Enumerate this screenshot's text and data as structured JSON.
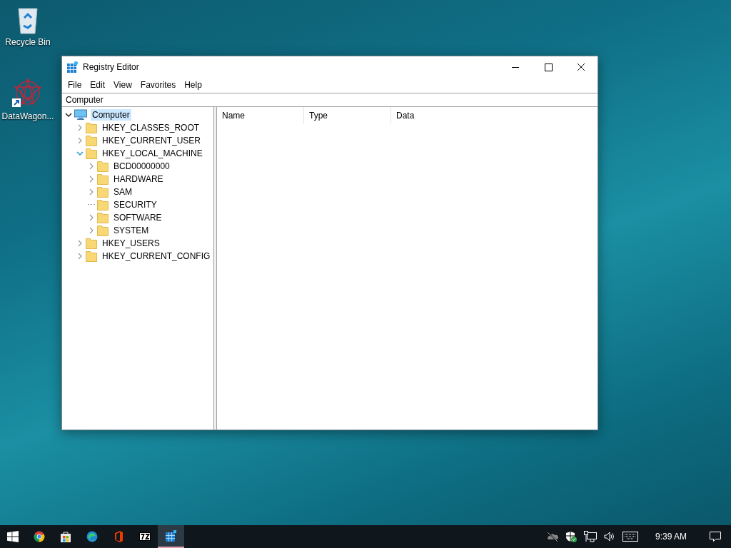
{
  "desktop_icons": [
    {
      "kind": "recycle",
      "label": "Recycle Bin"
    },
    {
      "kind": "shortcut",
      "label": "DataWagon..."
    }
  ],
  "window": {
    "title": "Registry Editor",
    "menu": [
      "File",
      "Edit",
      "View",
      "Favorites",
      "Help"
    ],
    "address": "Computer",
    "tree": [
      {
        "label": "Computer",
        "kind": "computer",
        "expandable": true,
        "expanded": true,
        "selected": true,
        "children": [
          {
            "label": "HKEY_CLASSES_ROOT",
            "kind": "folder",
            "expandable": true,
            "expanded": false,
            "selected": false
          },
          {
            "label": "HKEY_CURRENT_USER",
            "kind": "folder",
            "expandable": true,
            "expanded": false,
            "selected": false
          },
          {
            "label": "HKEY_LOCAL_MACHINE",
            "kind": "folder",
            "expandable": true,
            "expanded": true,
            "selected": false,
            "children": [
              {
                "label": "BCD00000000",
                "kind": "folder",
                "expandable": true,
                "expanded": false,
                "selected": false
              },
              {
                "label": "HARDWARE",
                "kind": "folder",
                "expandable": true,
                "expanded": false,
                "selected": false
              },
              {
                "label": "SAM",
                "kind": "folder",
                "expandable": true,
                "expanded": false,
                "selected": false
              },
              {
                "label": "SECURITY",
                "kind": "folder",
                "expandable": false,
                "selected": false
              },
              {
                "label": "SOFTWARE",
                "kind": "folder",
                "expandable": true,
                "expanded": false,
                "selected": false
              },
              {
                "label": "SYSTEM",
                "kind": "folder",
                "expandable": true,
                "expanded": false,
                "selected": false
              }
            ]
          },
          {
            "label": "HKEY_USERS",
            "kind": "folder",
            "expandable": true,
            "expanded": false,
            "selected": false
          },
          {
            "label": "HKEY_CURRENT_CONFIG",
            "kind": "folder",
            "expandable": true,
            "expanded": false,
            "selected": false
          }
        ]
      }
    ],
    "columns": [
      "Name",
      "Type",
      "Data"
    ]
  },
  "taskbar": {
    "apps": [
      {
        "kind": "chrome",
        "selected": false
      },
      {
        "kind": "store",
        "selected": false
      },
      {
        "kind": "edge",
        "selected": false
      },
      {
        "kind": "office",
        "selected": false
      },
      {
        "kind": "zip",
        "selected": false
      },
      {
        "kind": "regedit",
        "selected": true
      }
    ],
    "clock": "9:39 AM"
  }
}
